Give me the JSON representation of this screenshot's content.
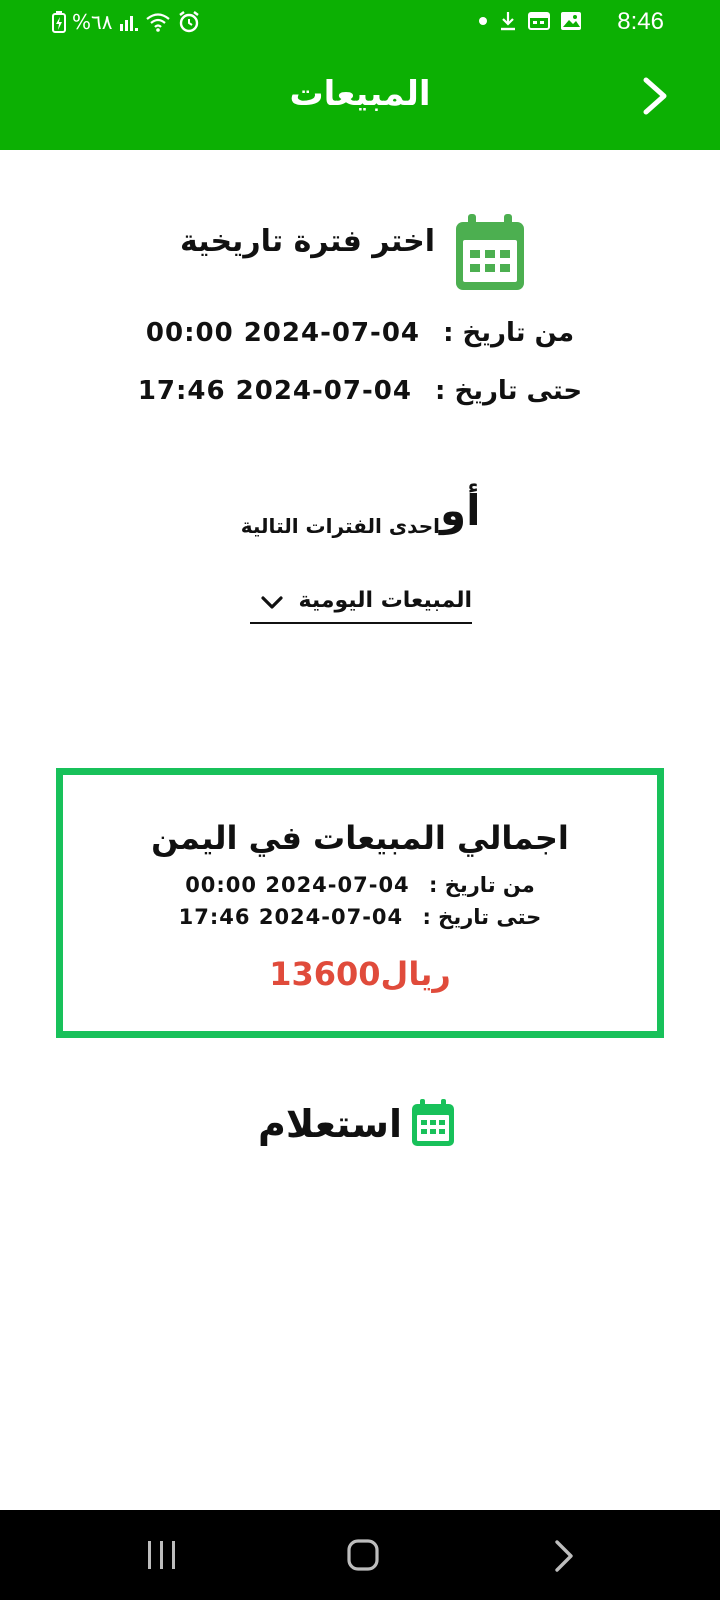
{
  "status_bar": {
    "battery_text": "%٦٨",
    "time": "8:46",
    "icons": [
      "battery-charging-icon",
      "signal-icon",
      "wifi-icon",
      "alarm-icon",
      "dot-icon",
      "download-icon",
      "calendar-notification-icon",
      "image-icon"
    ]
  },
  "app_bar": {
    "title": "المبيعات",
    "back_icon": "chevron-right-icon"
  },
  "date_picker": {
    "title": "اختر فترة تاريخية",
    "from_label": "من تاريخ :",
    "from_value": "00:00 2024-07-04",
    "to_label": "حتى تاريخ :",
    "to_value": "17:46 2024-07-04"
  },
  "or_section": {
    "or_big": "أو",
    "or_small": "احدى الفترات التالية"
  },
  "period_dropdown": {
    "selected": "المبيعات اليومية"
  },
  "totals_card": {
    "title": "اجمالي المبيعات في اليمن",
    "from_label": "من تاريخ :",
    "from_value": "00:00 2024-07-04",
    "to_label": "حتى تاريخ :",
    "to_value": "17:46 2024-07-04",
    "amount": "13600ريال"
  },
  "query_button": {
    "label": "استعلام"
  },
  "colors": {
    "primary_green": "#0cb003",
    "card_border": "#18c15a",
    "calendar_icon": "#4caf50",
    "amount_red": "#e04b3b"
  }
}
